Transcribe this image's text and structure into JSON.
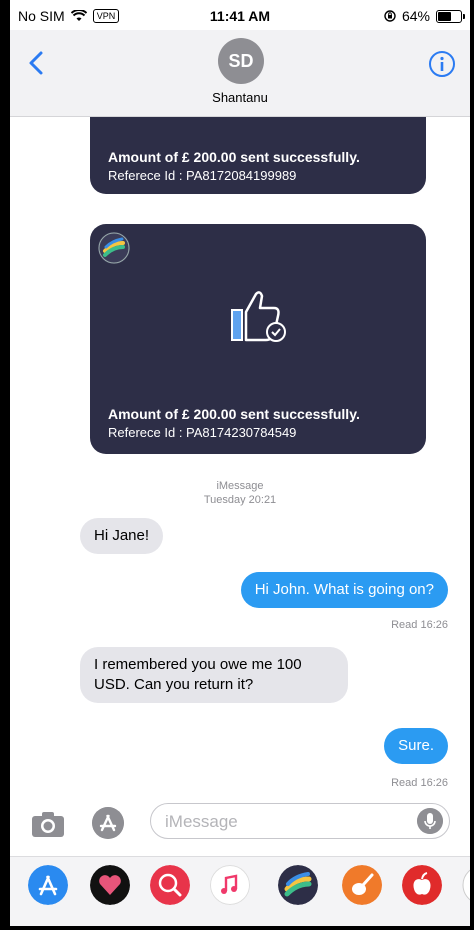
{
  "status_bar": {
    "carrier": "No SIM",
    "vpn": "VPN",
    "time": "11:41 AM",
    "battery": "64%",
    "battery_level": 0.64
  },
  "header": {
    "initials": "SD",
    "contact_name": "Shantanu"
  },
  "cards": [
    {
      "amount": "Amount of £ 200.00 sent successfully.",
      "reference": "Referece Id : PA8172084199989"
    },
    {
      "amount": "Amount of £ 200.00 sent successfully.",
      "reference": "Referece Id : PA8174230784549"
    }
  ],
  "separator": {
    "service": "iMessage",
    "timestamp": "Tuesday 20:21"
  },
  "messages": [
    {
      "direction": "in",
      "text": "Hi Jane!"
    },
    {
      "direction": "out",
      "text": "Hi John. What is going on?",
      "receipt": "Read 16:26"
    },
    {
      "direction": "in",
      "text": "I remembered you owe me 100 USD. Can you return it?"
    },
    {
      "direction": "out",
      "text": "Sure.",
      "receipt": "Read 16:26"
    }
  ],
  "composer": {
    "placeholder": "iMessage"
  },
  "colors": {
    "accent": "#2b9bf2",
    "card": "#2d2e47",
    "incoming": "#e5e5ea"
  },
  "app_drawer": [
    "app-store-icon",
    "heart-app-icon",
    "web-search-icon",
    "music-icon",
    "payment-app-icon",
    "garageband-icon",
    "apple-icon"
  ]
}
